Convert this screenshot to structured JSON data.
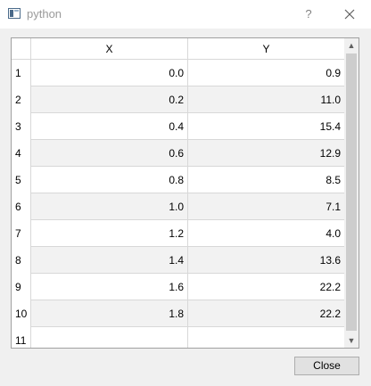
{
  "window": {
    "title": "python",
    "help_label": "?",
    "close_icon": "close-icon",
    "app_icon": "window-icon"
  },
  "table": {
    "columns": [
      "X",
      "Y"
    ],
    "rows": [
      {
        "label": "1",
        "x": "0.0",
        "y": "0.9"
      },
      {
        "label": "2",
        "x": "0.2",
        "y": "11.0"
      },
      {
        "label": "3",
        "x": "0.4",
        "y": "15.4"
      },
      {
        "label": "4",
        "x": "0.6",
        "y": "12.9"
      },
      {
        "label": "5",
        "x": "0.8",
        "y": "8.5"
      },
      {
        "label": "6",
        "x": "1.0",
        "y": "7.1"
      },
      {
        "label": "7",
        "x": "1.2",
        "y": "4.0"
      },
      {
        "label": "8",
        "x": "1.4",
        "y": "13.6"
      },
      {
        "label": "9",
        "x": "1.6",
        "y": "22.2"
      },
      {
        "label": "10",
        "x": "1.8",
        "y": "22.2"
      },
      {
        "label": "11",
        "x": "",
        "y": ""
      }
    ]
  },
  "buttons": {
    "close_label": "Close"
  }
}
